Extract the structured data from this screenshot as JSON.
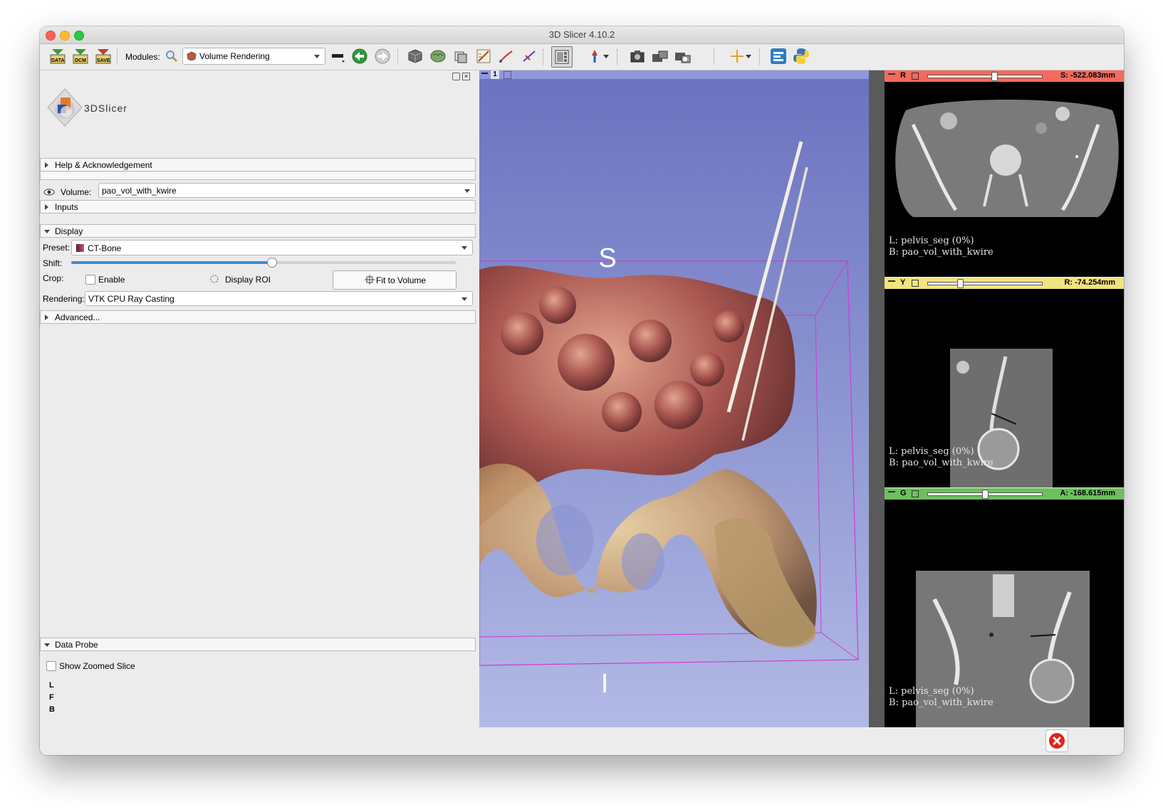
{
  "window": {
    "title": "3D Slicer 4.10.2"
  },
  "toolbar": {
    "data_label": "DATA",
    "dcm_label": "DCM",
    "save_label": "SAVE",
    "modules_label": "Modules:",
    "module_selected": "Volume Rendering"
  },
  "panel": {
    "logo_text": "3DSlicer",
    "help_section": "Help & Acknowledgement",
    "volume_label": "Volume:",
    "volume_value": "pao_vol_with_kwire",
    "inputs_section": "Inputs",
    "display_section": "Display",
    "preset_label": "Preset:",
    "preset_value": "CT-Bone",
    "shift_label": "Shift:",
    "shift_level": 0.52,
    "crop_label": "Crop:",
    "enable_label": "Enable",
    "display_roi_label": "Display ROI",
    "fit_button": "Fit to Volume",
    "rendering_label": "Rendering:",
    "rendering_value": "VTK CPU Ray Casting",
    "advanced_section": "Advanced...",
    "data_probe_section": "Data Probe",
    "show_zoomed_label": "Show Zoomed Slice",
    "probe_rows": [
      "L",
      "F",
      "B"
    ]
  },
  "view3d": {
    "view_number": "1",
    "orientation_top": "S",
    "orientation_bottom": "I"
  },
  "slices": [
    {
      "letter": "R",
      "color": "#f46a5c",
      "value": "S: -522.083mm",
      "slider_level": 0.58,
      "line1": "L: pelvis_seg (0%)",
      "line2": "B: pao_vol_with_kwire"
    },
    {
      "letter": "Y",
      "color": "#f1e47c",
      "value": "R: -74.254mm",
      "slider_level": 0.28,
      "line1": "L: pelvis_seg (0%)",
      "line2": "B: pao_vol_with_kwire"
    },
    {
      "letter": "G",
      "color": "#6fbf5f",
      "value": "A: -168.615mm",
      "slider_level": 0.5,
      "line1": "L: pelvis_seg (0%)",
      "line2": "B: pao_vol_with_kwire"
    }
  ]
}
